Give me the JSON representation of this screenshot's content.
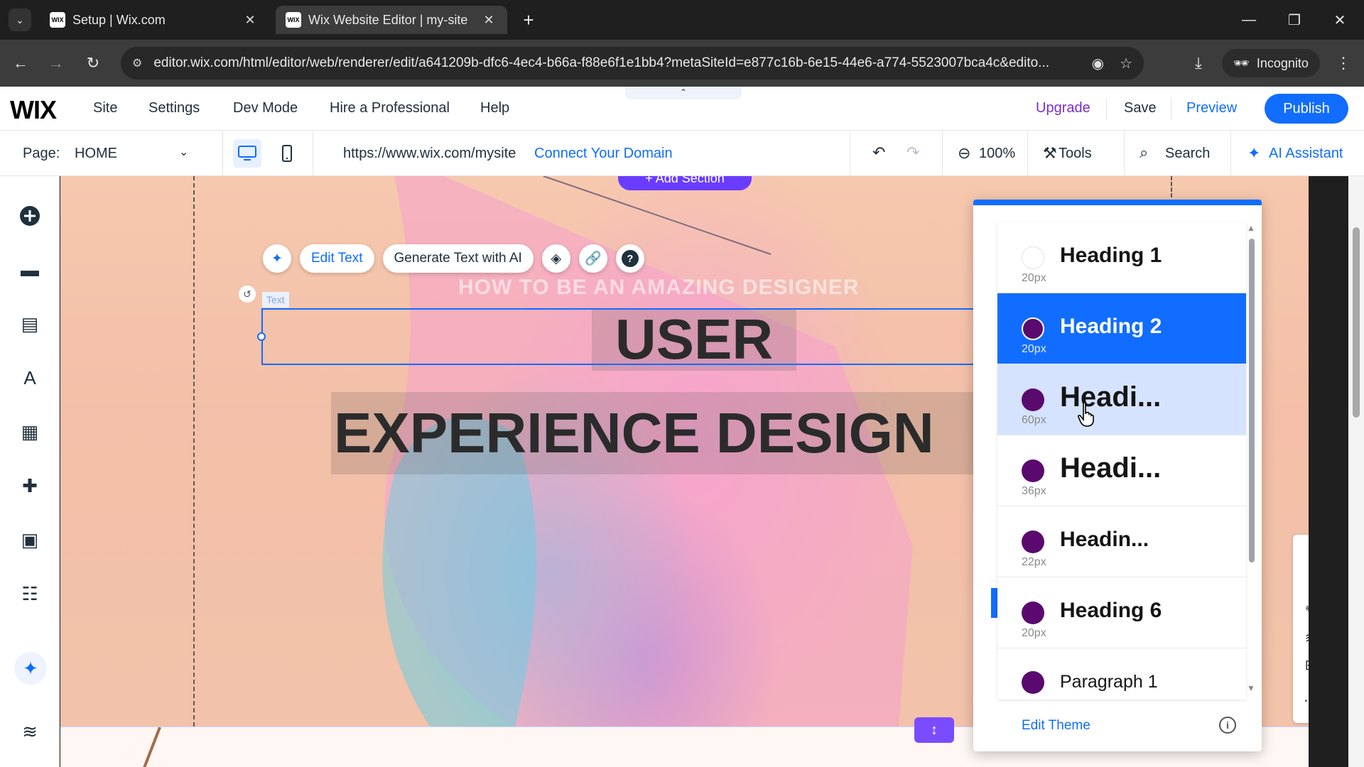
{
  "browser": {
    "tabs": [
      {
        "favicon": "WIX",
        "title": "Setup | Wix.com",
        "active": false
      },
      {
        "favicon": "WIX",
        "title": "Wix Website Editor | my-site",
        "active": true
      }
    ],
    "url": "editor.wix.com/html/editor/web/renderer/edit/a641209b-dfc6-4ec4-b66a-f88e6f1e1bb4?metaSiteId=e877c16b-6e15-44e6-a774-5523007bca4c&edito...",
    "incognito_label": "Incognito"
  },
  "wix_topbar": {
    "logo": "WIX",
    "menu": [
      "Site",
      "Settings",
      "Dev Mode",
      "Hire a Professional",
      "Help"
    ],
    "upgrade": "Upgrade",
    "save": "Save",
    "preview": "Preview",
    "publish": "Publish"
  },
  "pagebar": {
    "page_label": "Page:",
    "page_value": "HOME",
    "site_url": "https://www.wix.com/mysite",
    "connect_domain": "Connect Your Domain",
    "zoom": "100%",
    "tools": "Tools",
    "search": "Search",
    "ai_assistant": "AI Assistant"
  },
  "canvas": {
    "add_section": "+ Add Section",
    "toolbar": {
      "edit_text": "Edit Text",
      "generate": "Generate Text with AI"
    },
    "text_tag": "Text",
    "subheading": "HOW TO BE AN AMAZING DESIGNER",
    "heading_line1": "USER",
    "heading_line2": "EXPERIENCE DESIGN"
  },
  "text_styles_panel": {
    "items": [
      {
        "name": "Heading 1",
        "size": "20px",
        "state": "normal",
        "dot": "empty"
      },
      {
        "name": "Heading 2",
        "size": "20px",
        "state": "selected",
        "dot": "purple"
      },
      {
        "name": "Headi...",
        "size": "60px",
        "state": "hover",
        "dot": "purple"
      },
      {
        "name": "Headi...",
        "size": "36px",
        "state": "normal",
        "dot": "purple"
      },
      {
        "name": "Headin...",
        "size": "22px",
        "state": "normal",
        "dot": "purple"
      },
      {
        "name": "Heading 6",
        "size": "20px",
        "state": "normal",
        "dot": "purple"
      },
      {
        "name": "Paragraph 1",
        "size": "",
        "state": "normal",
        "dot": "purple"
      }
    ],
    "edit_theme": "Edit Theme"
  },
  "colors": {
    "wix_blue": "#116dff",
    "upgrade_purple": "#7a2cd0",
    "style_dot": "#5a0a6e"
  }
}
